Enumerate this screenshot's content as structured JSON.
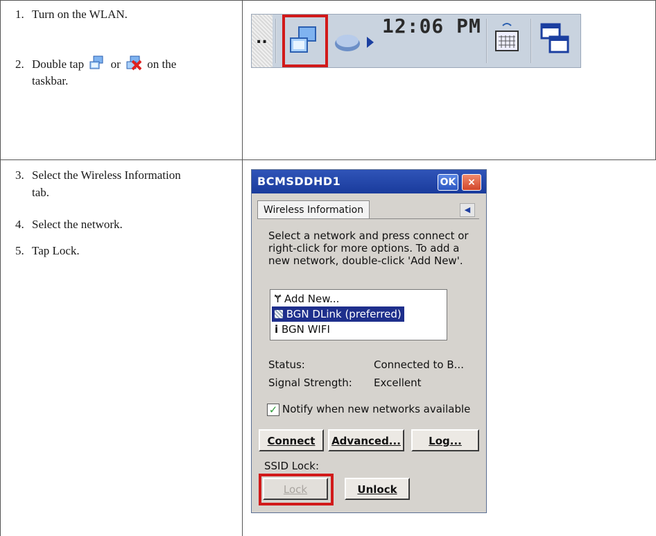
{
  "steps": [
    {
      "num": "1.",
      "text": "Turn on the WLAN."
    },
    {
      "num": "2.",
      "pre": "Double tap",
      "mid": "or",
      "post1": "on the",
      "post2": "taskbar."
    },
    {
      "num": "3.",
      "text1": "Select the Wireless Information",
      "text2": "tab."
    },
    {
      "num": "4.",
      "text": "Select the network."
    },
    {
      "num": "5.",
      "text": "Tap Lock."
    }
  ],
  "taskbar": {
    "overflow": "..",
    "clock": "12:06 PM",
    "icons": [
      "wlan-connected-icon",
      "sync-icon",
      "keyboard-icon",
      "windows-switch-icon"
    ]
  },
  "dialog": {
    "title": "BCMSDDHD1",
    "ok": "OK",
    "close": "×",
    "tab": "Wireless Information",
    "description": "Select a network and press connect or right-click for more options.  To add a new network, double-click 'Add New'.",
    "networks": [
      {
        "label": "Add New...",
        "icon": "antenna-icon",
        "selected": false
      },
      {
        "label": "BGN DLink (preferred)",
        "icon": "network-icon",
        "selected": true
      },
      {
        "label": "BGN WIFI",
        "icon": "signal-icon",
        "selected": false
      }
    ],
    "status_label": "Status:",
    "status_value": "Connected to B...",
    "signal_label": "Signal Strength:",
    "signal_value": "Excellent",
    "notify_label": "Notify when new networks available",
    "notify_checked": true,
    "connect": "Connect",
    "advanced": "Advanced...",
    "log": "Log...",
    "ssid_lock_label": "SSID Lock:",
    "lock": "Lock",
    "unlock": "Unlock"
  },
  "colors": {
    "highlight": "#d11a1a",
    "titlebar": "#1a3b9c",
    "selection": "#1e2f8c"
  }
}
